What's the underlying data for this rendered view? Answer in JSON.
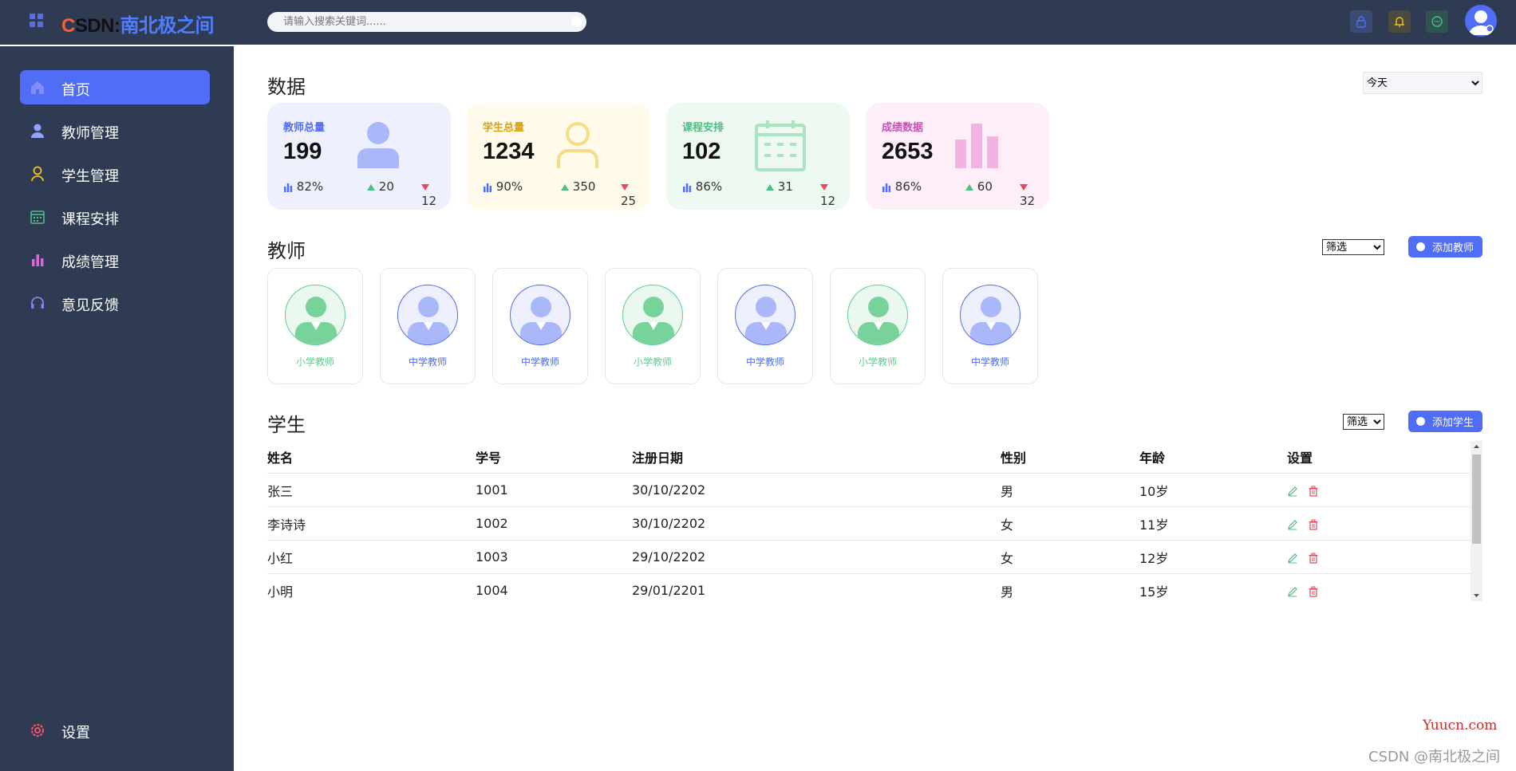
{
  "header": {
    "brand_c": "C",
    "brand_sdn": "SDN:",
    "brand_name": "南北极之间",
    "search_placeholder": "请输入搜索关键词......",
    "icons": [
      "lock-icon",
      "bell-icon",
      "chat-icon"
    ],
    "colors": {
      "bg": "#2f3b52",
      "accent": "#4f6df5"
    }
  },
  "sidebar": {
    "items": [
      {
        "label": "首页",
        "icon": "home-icon",
        "active": true
      },
      {
        "label": "教师管理",
        "icon": "user-icon"
      },
      {
        "label": "学生管理",
        "icon": "student-icon"
      },
      {
        "label": "课程安排",
        "icon": "calendar-icon"
      },
      {
        "label": "成绩管理",
        "icon": "bar-chart-icon"
      },
      {
        "label": "意见反馈",
        "icon": "headset-icon"
      }
    ],
    "settings_label": "设置"
  },
  "data_section": {
    "title": "数据",
    "period": "今天",
    "cards": [
      {
        "title": "教师总量",
        "value": "199",
        "pct": "82%",
        "up": "20",
        "down": "12",
        "color": "#4f6df5"
      },
      {
        "title": "学生总量",
        "value": "1234",
        "pct": "90%",
        "up": "350",
        "down": "25",
        "color": "#e8b92a"
      },
      {
        "title": "课程安排",
        "value": "102",
        "pct": "86%",
        "up": "31",
        "down": "12",
        "color": "#4dbf84"
      },
      {
        "title": "成绩数据",
        "value": "2653",
        "pct": "86%",
        "up": "60",
        "down": "32",
        "color": "#c94fb8"
      }
    ]
  },
  "teachers_section": {
    "title": "教师",
    "filter": "筛选",
    "add_label": "添加教师",
    "teachers": [
      {
        "label": "小学教师",
        "type": "primary"
      },
      {
        "label": "中学教师",
        "type": "middle"
      },
      {
        "label": "中学教师",
        "type": "middle"
      },
      {
        "label": "小学教师",
        "type": "primary"
      },
      {
        "label": "中学教师",
        "type": "middle"
      },
      {
        "label": "小学教师",
        "type": "primary"
      },
      {
        "label": "中学教师",
        "type": "middle"
      }
    ]
  },
  "students_section": {
    "title": "学生",
    "filter": "筛选",
    "add_label": "添加学生",
    "columns": [
      "姓名",
      "学号",
      "注册日期",
      "性别",
      "年龄",
      "设置"
    ],
    "rows": [
      [
        "张三",
        "1001",
        "30/10/2202",
        "男",
        "10岁"
      ],
      [
        "李诗诗",
        "1002",
        "30/10/2202",
        "女",
        "11岁"
      ],
      [
        "小红",
        "1003",
        "29/10/2202",
        "女",
        "12岁"
      ],
      [
        "小明",
        "1004",
        "29/01/2201",
        "男",
        "15岁"
      ]
    ]
  },
  "watermarks": {
    "site": "Yuucn.com",
    "author": "CSDN @南北极之间"
  }
}
